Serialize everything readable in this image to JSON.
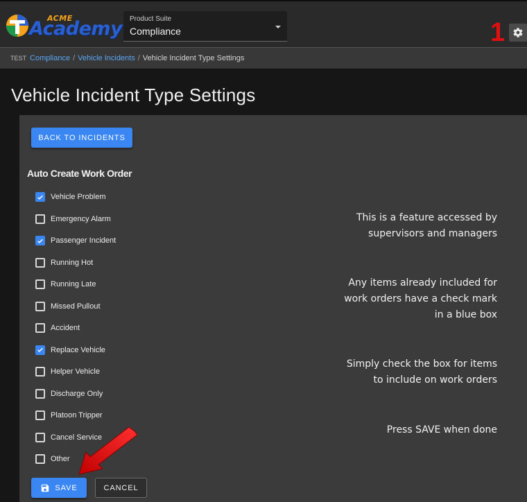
{
  "header": {
    "logo_top": "ACME",
    "logo_main": "Academy",
    "product_suite_label": "Product Suite",
    "product_suite_value": "Compliance",
    "notification_count": "1"
  },
  "breadcrumb": {
    "env": "TEST",
    "items": [
      "Compliance",
      "Vehicle Incidents"
    ],
    "current": "Vehicle Incident Type Settings"
  },
  "page": {
    "title": "Vehicle Incident Type Settings",
    "back_button": "BACK TO INCIDENTS",
    "section_title": "Auto Create Work Order",
    "save_button": "SAVE",
    "cancel_button": "CANCEL"
  },
  "incident_types": [
    {
      "label": "Vehicle Problem",
      "checked": true
    },
    {
      "label": "Emergency Alarm",
      "checked": false
    },
    {
      "label": "Passenger Incident",
      "checked": true
    },
    {
      "label": "Running Hot",
      "checked": false
    },
    {
      "label": "Running Late",
      "checked": false
    },
    {
      "label": "Missed Pullout",
      "checked": false
    },
    {
      "label": "Accident",
      "checked": false
    },
    {
      "label": "Replace Vehicle",
      "checked": true
    },
    {
      "label": "Helper Vehicle",
      "checked": false
    },
    {
      "label": "Discharge Only",
      "checked": false
    },
    {
      "label": "Platoon Tripper",
      "checked": false
    },
    {
      "label": "Cancel Service",
      "checked": false
    },
    {
      "label": "Other",
      "checked": false
    }
  ],
  "annotations": {
    "a1_line1": "This is a feature accessed by",
    "a1_line2": "supervisors and managers",
    "a2_line1": "Any items already included for",
    "a2_line2": "work orders have a check mark",
    "a2_line3": "in a blue box",
    "a3_line1": "Simply check the box for items",
    "a3_line2": "to include on work orders",
    "a4_line1": "Press SAVE when done"
  },
  "colors": {
    "accent_blue": "#3a86f2",
    "link_blue": "#5aa7f5",
    "annotation_red": "#e01010"
  },
  "icons": {
    "settings": "gear-icon",
    "save": "floppy-disk-icon",
    "checkbox": "check-icon",
    "dropdown": "chevron-down-icon"
  }
}
